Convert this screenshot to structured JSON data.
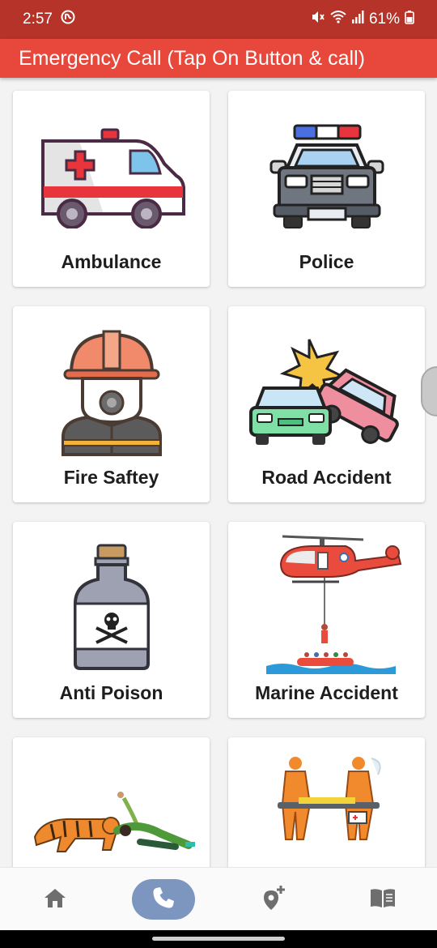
{
  "status": {
    "time": "2:57",
    "battery": "61%"
  },
  "app": {
    "title": "Emergency Call  (Tap On Button & call)"
  },
  "services": [
    {
      "label": "Ambulance",
      "icon": "ambulance-icon"
    },
    {
      "label": "Police",
      "icon": "police-car-icon"
    },
    {
      "label": "Fire Saftey",
      "icon": "firefighter-icon"
    },
    {
      "label": "Road Accident",
      "icon": "car-crash-icon"
    },
    {
      "label": "Anti Poison",
      "icon": "poison-bottle-icon"
    },
    {
      "label": "Marine Accident",
      "icon": "rescue-helicopter-icon"
    },
    {
      "label": "",
      "icon": "tiger-attack-icon"
    },
    {
      "label": "",
      "icon": "stretcher-rescue-icon"
    }
  ],
  "nav": {
    "items": [
      "home-icon",
      "phone-icon",
      "location-add-icon",
      "book-icon"
    ],
    "active": "phone-icon"
  },
  "colors": {
    "statusbar": "#b53328",
    "appbar": "#e8483c",
    "nav_active": "#7d96c0"
  }
}
